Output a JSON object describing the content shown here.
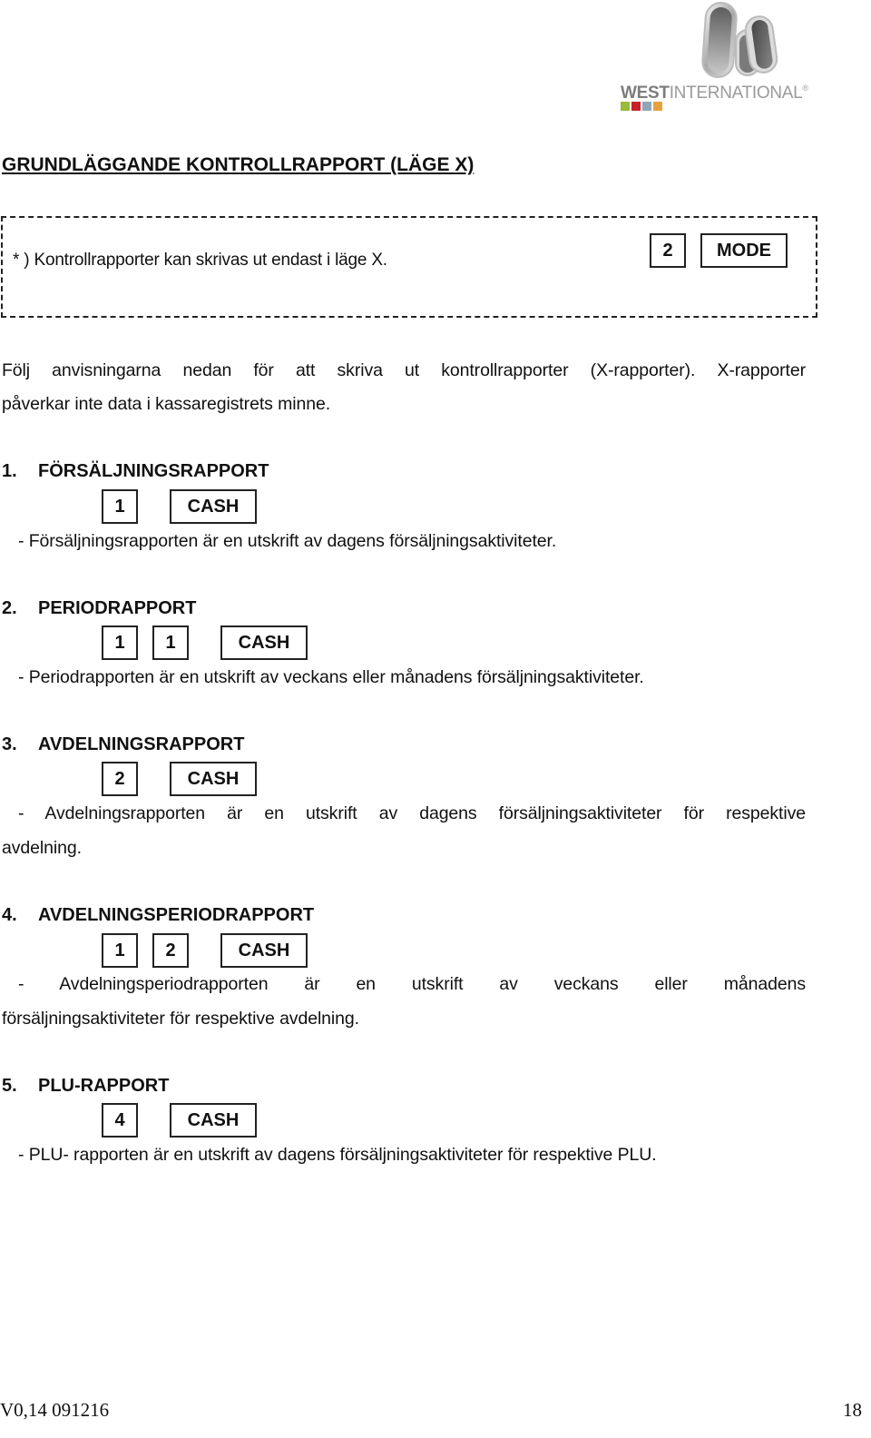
{
  "logo": {
    "brand_bold": "WEST",
    "brand_light": "INTERNATIONAL",
    "registered_mark": "®",
    "square_colors": [
      "#9bbb3b",
      "#c8202a",
      "#8fa6b8",
      "#e8a23c"
    ]
  },
  "title": "GRUNDLÄGGANDE KONTROLLRAPPORT (LÄGE X)",
  "note": {
    "text": "* ) Kontrollrapporter kan skrivas ut endast i läge X.",
    "keys": [
      "2",
      "MODE"
    ]
  },
  "intro": {
    "line1": "Följ anvisningarna nedan för att skriva ut kontrollrapporter (X-rapporter). X-rapporter",
    "line2": "påverkar inte data i kassaregistrets minne."
  },
  "sections": [
    {
      "number": "1.",
      "heading": "FÖRSÄLJNINGSRAPPORT",
      "keys": [
        "1",
        "CASH"
      ],
      "description": "- Försäljningsrapporten är en utskrift av dagens försäljningsaktiviteter."
    },
    {
      "number": "2.",
      "heading": "PERIODRAPPORT",
      "keys": [
        "1",
        "1",
        "CASH"
      ],
      "description": "- Periodrapporten är en utskrift av veckans eller månadens försäljningsaktiviteter."
    },
    {
      "number": "3.",
      "heading": "AVDELNINGSRAPPORT",
      "keys": [
        "2",
        "CASH"
      ],
      "description_line1": "- Avdelningsrapporten är en utskrift av dagens försäljningsaktiviteter för respektive",
      "description_line2": "avdelning."
    },
    {
      "number": "4.",
      "heading": "AVDELNINGSPERIODRAPPORT",
      "keys": [
        "1",
        "2",
        "CASH"
      ],
      "description_line1": "- Avdelningsperiodrapporten är en utskrift av veckans eller månadens",
      "description_line2": "försäljningsaktiviteter för respektive avdelning."
    },
    {
      "number": "5.",
      "heading": "PLU-RAPPORT",
      "keys": [
        "4",
        "CASH"
      ],
      "description": "- PLU- rapporten är en utskrift av dagens försäljningsaktiviteter för respektive PLU."
    }
  ],
  "footer": {
    "version": "V0,14 091216",
    "page_number": "18"
  }
}
